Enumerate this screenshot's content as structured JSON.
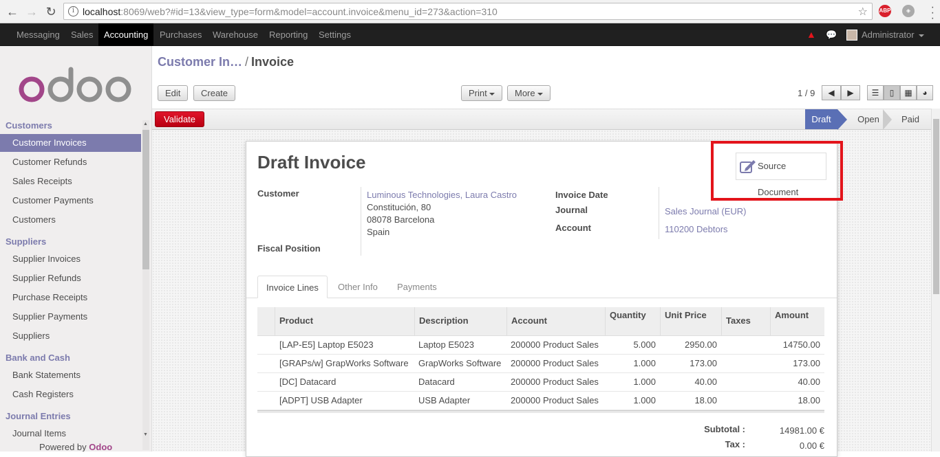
{
  "browser": {
    "url_host": "localhost",
    "url_rest": ":8069/web?#id=13&view_type=form&model=account.invoice&menu_id=273&action=310",
    "ext_abp": "ABP"
  },
  "topmenu": {
    "items": [
      "Messaging",
      "Sales",
      "Accounting",
      "Purchases",
      "Warehouse",
      "Reporting",
      "Settings"
    ],
    "active": "Accounting",
    "user": "Administrator"
  },
  "sidebar": {
    "logo": "odoo",
    "sections": [
      {
        "title": "Customers",
        "items": [
          "Customer Invoices",
          "Customer Refunds",
          "Sales Receipts",
          "Customer Payments",
          "Customers"
        ]
      },
      {
        "title": "Suppliers",
        "items": [
          "Supplier Invoices",
          "Supplier Refunds",
          "Purchase Receipts",
          "Supplier Payments",
          "Suppliers"
        ]
      },
      {
        "title": "Bank and Cash",
        "items": [
          "Bank Statements",
          "Cash Registers"
        ]
      },
      {
        "title": "Journal Entries",
        "items": [
          "Journal Items"
        ]
      }
    ],
    "active_item": "Customer Invoices",
    "powered_by": "Powered by",
    "powered_brand": "Odoo"
  },
  "breadcrumb": {
    "parent": "Customer In…",
    "separator": "/",
    "current": "Invoice"
  },
  "toolbar": {
    "edit": "Edit",
    "create": "Create",
    "print": "Print",
    "more": "More",
    "pager": "1 / 9"
  },
  "status": {
    "validate": "Validate",
    "stages": [
      "Draft",
      "Open",
      "Paid"
    ],
    "current": "Draft"
  },
  "invoice": {
    "title": "Draft Invoice",
    "source_document": "Source Document",
    "customer_label": "Customer",
    "customer_name": "Luminous Technologies, Laura Castro",
    "address": [
      "Constitución, 80",
      "08078 Barcelona",
      "Spain"
    ],
    "fiscal_position_label": "Fiscal Position",
    "invoice_date_label": "Invoice Date",
    "journal_label": "Journal",
    "journal": "Sales Journal (EUR)",
    "account_label": "Account",
    "account": "110200 Debtors"
  },
  "tabs": [
    "Invoice Lines",
    "Other Info",
    "Payments"
  ],
  "lines": {
    "headers": [
      "Product",
      "Description",
      "Account",
      "Quantity",
      "Unit Price",
      "Taxes",
      "Amount"
    ],
    "rows": [
      [
        "[LAP-E5] Laptop E5023",
        "Laptop E5023",
        "200000 Product Sales",
        "5.000",
        "2950.00",
        "",
        "14750.00"
      ],
      [
        "[GRAPs/w] GrapWorks Software",
        "GrapWorks Software",
        "200000 Product Sales",
        "1.000",
        "173.00",
        "",
        "173.00"
      ],
      [
        "[DC] Datacard",
        "Datacard",
        "200000 Product Sales",
        "1.000",
        "40.00",
        "",
        "40.00"
      ],
      [
        "[ADPT] USB Adapter",
        "USB Adapter",
        "200000 Product Sales",
        "1.000",
        "18.00",
        "",
        "18.00"
      ]
    ]
  },
  "totals": {
    "subtotal_label": "Subtotal :",
    "subtotal": "14981.00 €",
    "tax_label": "Tax :",
    "tax": "0.00 €"
  }
}
